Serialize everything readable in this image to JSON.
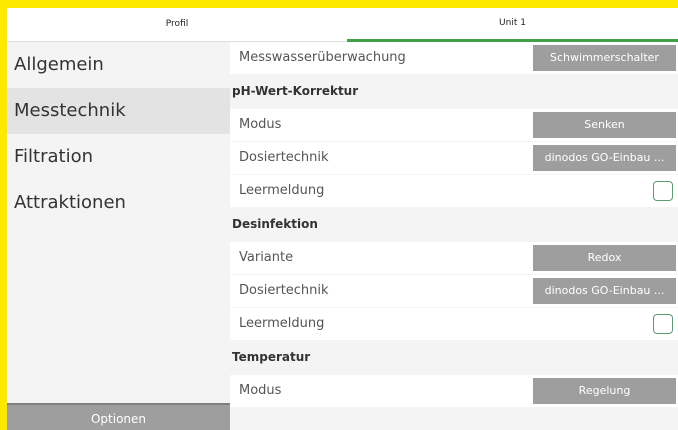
{
  "tabs": {
    "profil": "Profil",
    "unit": "Unit 1"
  },
  "sidebar": {
    "items": [
      {
        "label": "Allgemein"
      },
      {
        "label": "Messtechnik"
      },
      {
        "label": "Filtration"
      },
      {
        "label": "Attraktionen"
      }
    ],
    "options_label": "Optionen"
  },
  "content": {
    "messwasser": {
      "label": "Messwasserüberwachung",
      "value": "Schwimmerschalter"
    },
    "ph": {
      "title": "pH-Wert-Korrektur",
      "modus": {
        "label": "Modus",
        "value": "Senken"
      },
      "dosier": {
        "label": "Dosiertechnik",
        "value": "dinodos GO-Einbau ..."
      },
      "leer": {
        "label": "Leermeldung",
        "checked": false
      }
    },
    "desinfektion": {
      "title": "Desinfektion",
      "variante": {
        "label": "Variante",
        "value": "Redox"
      },
      "dosier": {
        "label": "Dosiertechnik",
        "value": "dinodos GO-Einbau ..."
      },
      "leer": {
        "label": "Leermeldung",
        "checked": false
      }
    },
    "temperatur": {
      "title": "Temperatur",
      "modus": {
        "label": "Modus",
        "value": "Regelung"
      }
    }
  },
  "colors": {
    "frame": "#fde800",
    "accent": "#43a047",
    "button": "#9e9e9e",
    "checkbox_border": "#5e9a74"
  }
}
